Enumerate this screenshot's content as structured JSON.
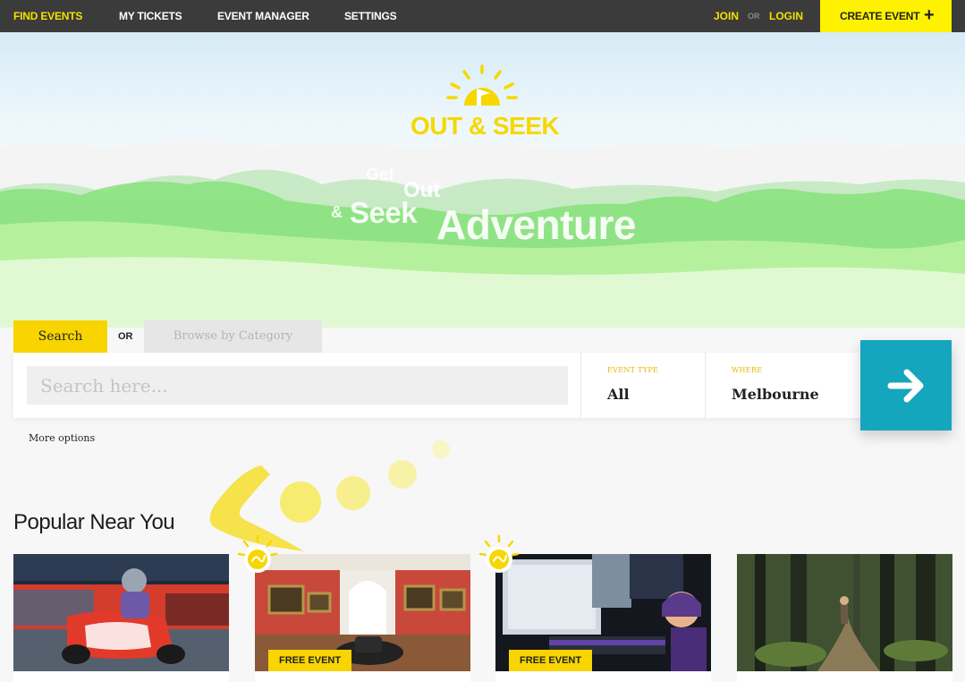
{
  "nav": {
    "items": [
      {
        "label": "FIND EVENTS",
        "active": true
      },
      {
        "label": "MY TICKETS",
        "active": false
      },
      {
        "label": "EVENT MANAGER",
        "active": false
      },
      {
        "label": "SETTINGS",
        "active": false
      }
    ],
    "join": "JOIN",
    "or": "OR",
    "login": "LOGIN",
    "create_event": "CREATE EVENT",
    "create_icon": "+"
  },
  "hero": {
    "logo_text": "OUT & SEEK",
    "logo_icon": "sun-flag-icon",
    "tagline": {
      "get": "Get",
      "out": "Out",
      "amp": "&",
      "seek": "Seek",
      "adventure": "Adventure"
    }
  },
  "search": {
    "tab_search": "Search",
    "or": "OR",
    "tab_browse": "Browse by Category",
    "placeholder": "Search here...",
    "event_type_label": "EVENT TYPE",
    "event_type_value": "All",
    "where_label": "WHERE",
    "where_value": "Melbourne",
    "go_icon": "arrow-right-icon",
    "more_options": "More options"
  },
  "popular": {
    "title": "Popular Near You",
    "cards": [
      {
        "image": "go-kart-racing",
        "badge": ""
      },
      {
        "image": "art-gallery",
        "badge": "FREE EVENT"
      },
      {
        "image": "gaming",
        "badge": "FREE EVENT"
      },
      {
        "image": "forest-hike",
        "badge": ""
      }
    ]
  },
  "colors": {
    "accent_yellow": "#f8d400",
    "nav_bg": "#3b3b3b",
    "go_button": "#14a6bd",
    "create_button": "#fff200"
  }
}
